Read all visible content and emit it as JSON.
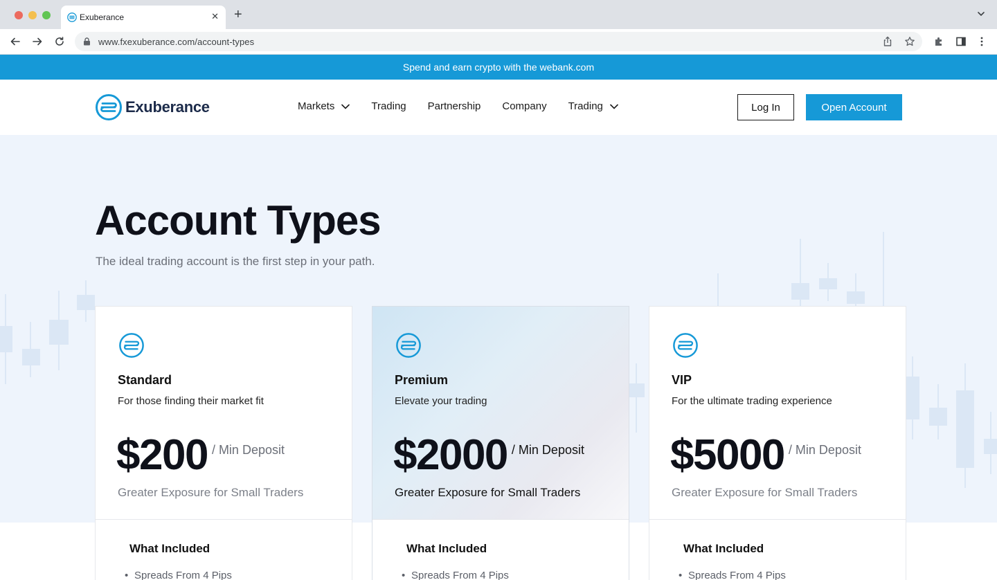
{
  "browser": {
    "tab_title": "Exuberance",
    "url": "www.fxexuberance.com/account-types"
  },
  "promo": {
    "text": "Spend and earn crypto with the webank.com"
  },
  "header": {
    "logo_text": "Exuberance",
    "nav": [
      {
        "label": "Markets",
        "has_dropdown": true
      },
      {
        "label": "Trading",
        "has_dropdown": false
      },
      {
        "label": "Partnership",
        "has_dropdown": false
      },
      {
        "label": "Company",
        "has_dropdown": false
      },
      {
        "label": "Trading",
        "has_dropdown": true
      }
    ],
    "login_label": "Log In",
    "open_account_label": "Open Account"
  },
  "hero": {
    "title": "Account Types",
    "subtitle": "The ideal trading account is the first step in your path."
  },
  "cards": [
    {
      "name": "Standard",
      "tagline": "For those finding their market fit",
      "price": "$200",
      "price_note": "/ Min Deposit",
      "description": "Greater Exposure for Small Traders",
      "included_title": "What Included",
      "included_items": [
        "Spreads From 4 Pips"
      ]
    },
    {
      "name": "Premium",
      "tagline": "Elevate your trading",
      "price": "$2000",
      "price_note": "/ Min Deposit",
      "description": "Greater Exposure for Small Traders",
      "included_title": "What Included",
      "included_items": [
        "Spreads From 4 Pips"
      ]
    },
    {
      "name": "VIP",
      "tagline": "For the ultimate trading experience",
      "price": "$5000",
      "price_note": "/ Min Deposit",
      "description": "Greater Exposure for Small Traders",
      "included_title": "What Included",
      "included_items": [
        "Spreads From 4 Pips"
      ]
    }
  ],
  "colors": {
    "brand_blue": "#1699d7",
    "logo_navy": "#1c2b4a",
    "hero_bg": "#eef4fc"
  }
}
